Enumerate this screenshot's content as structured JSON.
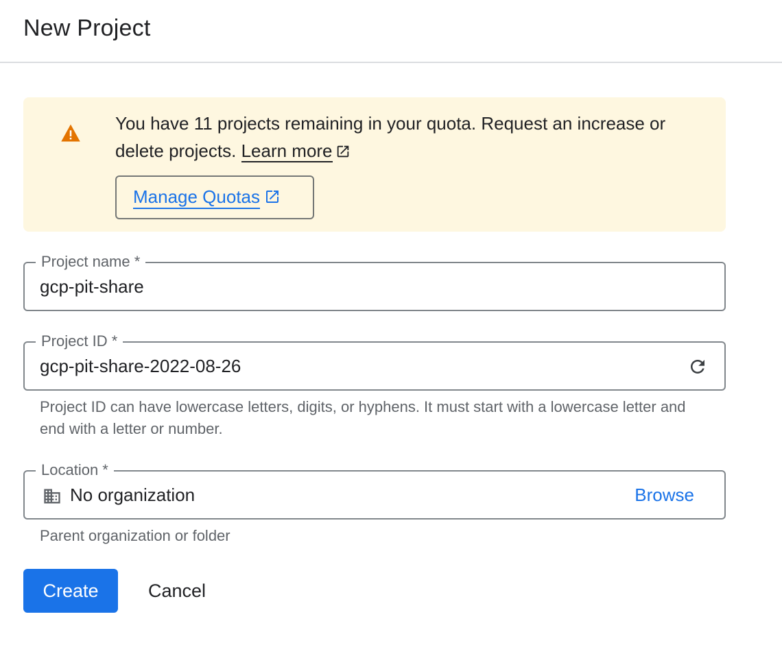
{
  "header": {
    "title": "New Project"
  },
  "quota_banner": {
    "message": "You have 11 projects remaining in your quota. Request an increase or delete projects.",
    "learn_more_label": "Learn more",
    "manage_quotas_label": "Manage Quotas",
    "icons": {
      "status": "warning-icon",
      "external": "open-in-new-icon"
    },
    "colors": {
      "background": "#fef7e0",
      "warning": "#e37400",
      "link": "#1a73e8"
    }
  },
  "project_name": {
    "label": "Project name *",
    "value": "gcp-pit-share"
  },
  "project_id": {
    "label": "Project ID *",
    "value": "gcp-pit-share-2022-08-26",
    "hint": "Project ID can have lowercase letters, digits, or hyphens. It must start with a lowercase letter and end with a letter or number.",
    "icon": "refresh-icon"
  },
  "location": {
    "label": "Location *",
    "value": "No organization",
    "browse_label": "Browse",
    "hint": "Parent organization or folder",
    "icon": "domain-building-icon"
  },
  "actions": {
    "create_label": "Create",
    "cancel_label": "Cancel",
    "primary_color": "#1a73e8"
  }
}
